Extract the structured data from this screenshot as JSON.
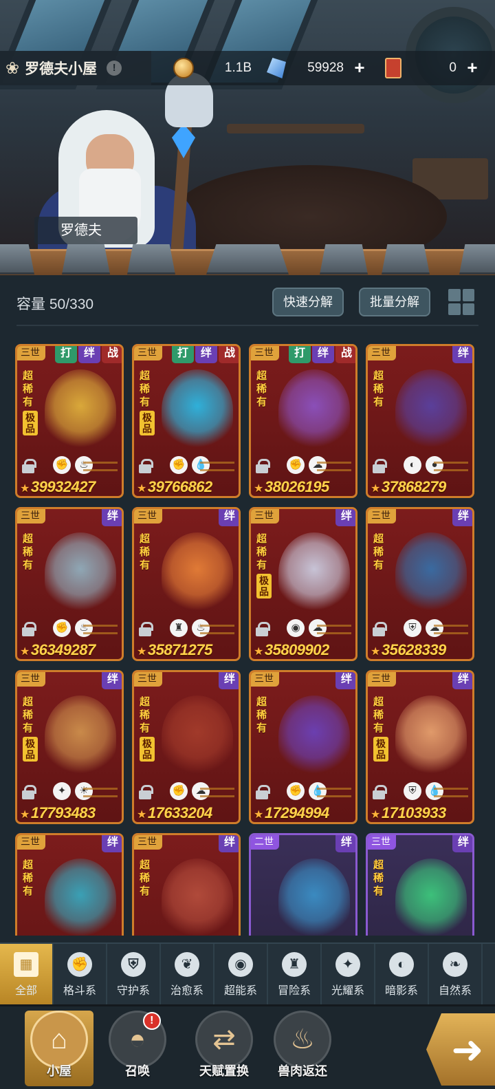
{
  "header": {
    "title": "罗德夫小屋",
    "info_icon": "!",
    "npc_name": "罗德夫"
  },
  "resources": {
    "gold": "1.1B",
    "crystal": "59928",
    "cards": "0",
    "plus": "+"
  },
  "container": {
    "capacity_label": "容量 50/330",
    "quick_decompose": "快速分解",
    "batch_decompose": "批量分解"
  },
  "cards": [
    {
      "gen": "三世",
      "tags": [
        "打",
        "绊",
        "战"
      ],
      "rarity": "超稀有",
      "quality": "极品",
      "elements": [
        "fist-icon",
        "fire-icon"
      ],
      "power": "39932427",
      "art_color": "#d9a83a"
    },
    {
      "gen": "三世",
      "tags": [
        "打",
        "绊",
        "战"
      ],
      "rarity": "超稀有",
      "quality": "极品",
      "elements": [
        "fist-icon",
        "water-icon"
      ],
      "power": "39766862",
      "art_color": "#2fb0d9"
    },
    {
      "gen": "三世",
      "tags": [
        "打",
        "绊",
        "战"
      ],
      "rarity": "超稀有",
      "quality": "",
      "elements": [
        "fist-icon",
        "earth-icon"
      ],
      "power": "38026195",
      "art_color": "#8a4fb8"
    },
    {
      "gen": "三世",
      "tags": [
        "绊"
      ],
      "rarity": "超稀有",
      "quality": "",
      "elements": [
        "shadow-icon",
        "dark-icon"
      ],
      "power": "37868279",
      "art_color": "#5a3f9a"
    },
    {
      "gen": "三世",
      "tags": [
        "绊"
      ],
      "rarity": "超稀有",
      "quality": "",
      "elements": [
        "fist-icon",
        "fire-icon"
      ],
      "power": "36349287",
      "art_color": "#8fa7b5"
    },
    {
      "gen": "三世",
      "tags": [
        "绊"
      ],
      "rarity": "超稀有",
      "quality": "",
      "elements": [
        "adventure-icon",
        "fire-icon"
      ],
      "power": "35871275",
      "art_color": "#e07a36"
    },
    {
      "gen": "三世",
      "tags": [
        "绊"
      ],
      "rarity": "超稀有",
      "quality": "极品",
      "elements": [
        "psychic-icon",
        "earth-icon"
      ],
      "power": "35809902",
      "art_color": "#c7c3d6"
    },
    {
      "gen": "三世",
      "tags": [
        "绊"
      ],
      "rarity": "超稀有",
      "quality": "",
      "elements": [
        "guard-icon",
        "earth-icon"
      ],
      "power": "35628339",
      "art_color": "#3a6aa0"
    },
    {
      "gen": "三世",
      "tags": [
        "绊"
      ],
      "rarity": "超稀有",
      "quality": "极品",
      "elements": [
        "light-icon",
        "sun-icon"
      ],
      "power": "17793483",
      "art_color": "#c98a4a"
    },
    {
      "gen": "三世",
      "tags": [
        "绊"
      ],
      "rarity": "超稀有",
      "quality": "极品",
      "elements": [
        "fist-icon",
        "earth-icon"
      ],
      "power": "17633204",
      "art_color": "#a13a2a"
    },
    {
      "gen": "三世",
      "tags": [
        "绊"
      ],
      "rarity": "超稀有",
      "quality": "",
      "elements": [
        "fist-icon",
        "water-icon"
      ],
      "power": "17294994",
      "art_color": "#6b3fb0"
    },
    {
      "gen": "三世",
      "tags": [
        "绊"
      ],
      "rarity": "超稀有",
      "quality": "极品",
      "elements": [
        "guard-icon",
        "water-icon"
      ],
      "power": "17103933",
      "art_color": "#e09a6a"
    },
    {
      "gen": "三世",
      "tags": [
        "绊"
      ],
      "rarity": "超稀有",
      "quality": "",
      "elements": [],
      "power": "",
      "art_color": "#3aa0b5"
    },
    {
      "gen": "三世",
      "tags": [
        "绊"
      ],
      "rarity": "超稀有",
      "quality": "",
      "elements": [],
      "power": "",
      "art_color": "#b04a3a"
    },
    {
      "gen": "二世",
      "tags": [
        "绊"
      ],
      "rarity": "",
      "quality": "",
      "elements": [],
      "power": "",
      "art_color": "#3a8ac0",
      "purple": true
    },
    {
      "gen": "三世",
      "tags": [
        "绊"
      ],
      "rarity": "超稀有",
      "quality": "",
      "elements": [],
      "power": "",
      "art_color": "#3cc07a",
      "purple": true
    }
  ],
  "categories": [
    {
      "label": "全部",
      "icon": "all-icon",
      "glyph": "▦",
      "active": true
    },
    {
      "label": "格斗系",
      "icon": "fist-icon",
      "glyph": "✊"
    },
    {
      "label": "守护系",
      "icon": "shield-icon",
      "glyph": "⛨"
    },
    {
      "label": "治愈系",
      "icon": "sprout-icon",
      "glyph": "❦"
    },
    {
      "label": "超能系",
      "icon": "alien-icon",
      "glyph": "◉"
    },
    {
      "label": "冒险系",
      "icon": "lantern-icon",
      "glyph": "♜"
    },
    {
      "label": "光耀系",
      "icon": "sparkle-icon",
      "glyph": "✦"
    },
    {
      "label": "暗影系",
      "icon": "eclipse-icon",
      "glyph": "◐"
    },
    {
      "label": "自然系",
      "icon": "leaf-icon",
      "glyph": "❧"
    }
  ],
  "nav": [
    {
      "label": "小屋",
      "icon": "house-icon",
      "glyph": "⌂",
      "active": true
    },
    {
      "label": "召唤",
      "icon": "egg-icon",
      "glyph": "◓",
      "badge": "!"
    },
    {
      "label": "天赋置换",
      "icon": "swap-icon",
      "glyph": "⇄"
    },
    {
      "label": "兽肉返还",
      "icon": "meat-icon",
      "glyph": "♨"
    }
  ],
  "go_button_icon": "arrow-icon"
}
